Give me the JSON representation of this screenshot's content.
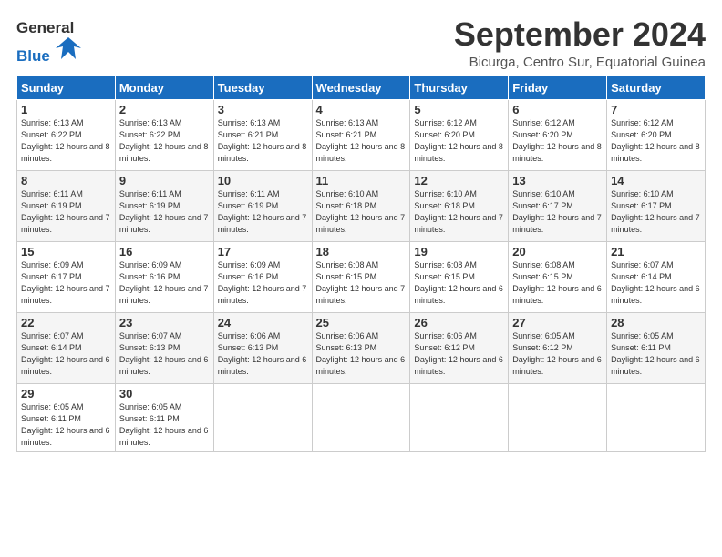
{
  "header": {
    "logo_general": "General",
    "logo_blue": "Blue",
    "title": "September 2024",
    "location": "Bicurga, Centro Sur, Equatorial Guinea"
  },
  "weekdays": [
    "Sunday",
    "Monday",
    "Tuesday",
    "Wednesday",
    "Thursday",
    "Friday",
    "Saturday"
  ],
  "weeks": [
    [
      {
        "day": "1",
        "sunrise": "6:13 AM",
        "sunset": "6:22 PM",
        "daylight": "12 hours and 8 minutes."
      },
      {
        "day": "2",
        "sunrise": "6:13 AM",
        "sunset": "6:22 PM",
        "daylight": "12 hours and 8 minutes."
      },
      {
        "day": "3",
        "sunrise": "6:13 AM",
        "sunset": "6:21 PM",
        "daylight": "12 hours and 8 minutes."
      },
      {
        "day": "4",
        "sunrise": "6:13 AM",
        "sunset": "6:21 PM",
        "daylight": "12 hours and 8 minutes."
      },
      {
        "day": "5",
        "sunrise": "6:12 AM",
        "sunset": "6:20 PM",
        "daylight": "12 hours and 8 minutes."
      },
      {
        "day": "6",
        "sunrise": "6:12 AM",
        "sunset": "6:20 PM",
        "daylight": "12 hours and 8 minutes."
      },
      {
        "day": "7",
        "sunrise": "6:12 AM",
        "sunset": "6:20 PM",
        "daylight": "12 hours and 8 minutes."
      }
    ],
    [
      {
        "day": "8",
        "sunrise": "6:11 AM",
        "sunset": "6:19 PM",
        "daylight": "12 hours and 7 minutes."
      },
      {
        "day": "9",
        "sunrise": "6:11 AM",
        "sunset": "6:19 PM",
        "daylight": "12 hours and 7 minutes."
      },
      {
        "day": "10",
        "sunrise": "6:11 AM",
        "sunset": "6:19 PM",
        "daylight": "12 hours and 7 minutes."
      },
      {
        "day": "11",
        "sunrise": "6:10 AM",
        "sunset": "6:18 PM",
        "daylight": "12 hours and 7 minutes."
      },
      {
        "day": "12",
        "sunrise": "6:10 AM",
        "sunset": "6:18 PM",
        "daylight": "12 hours and 7 minutes."
      },
      {
        "day": "13",
        "sunrise": "6:10 AM",
        "sunset": "6:17 PM",
        "daylight": "12 hours and 7 minutes."
      },
      {
        "day": "14",
        "sunrise": "6:10 AM",
        "sunset": "6:17 PM",
        "daylight": "12 hours and 7 minutes."
      }
    ],
    [
      {
        "day": "15",
        "sunrise": "6:09 AM",
        "sunset": "6:17 PM",
        "daylight": "12 hours and 7 minutes."
      },
      {
        "day": "16",
        "sunrise": "6:09 AM",
        "sunset": "6:16 PM",
        "daylight": "12 hours and 7 minutes."
      },
      {
        "day": "17",
        "sunrise": "6:09 AM",
        "sunset": "6:16 PM",
        "daylight": "12 hours and 7 minutes."
      },
      {
        "day": "18",
        "sunrise": "6:08 AM",
        "sunset": "6:15 PM",
        "daylight": "12 hours and 7 minutes."
      },
      {
        "day": "19",
        "sunrise": "6:08 AM",
        "sunset": "6:15 PM",
        "daylight": "12 hours and 6 minutes."
      },
      {
        "day": "20",
        "sunrise": "6:08 AM",
        "sunset": "6:15 PM",
        "daylight": "12 hours and 6 minutes."
      },
      {
        "day": "21",
        "sunrise": "6:07 AM",
        "sunset": "6:14 PM",
        "daylight": "12 hours and 6 minutes."
      }
    ],
    [
      {
        "day": "22",
        "sunrise": "6:07 AM",
        "sunset": "6:14 PM",
        "daylight": "12 hours and 6 minutes."
      },
      {
        "day": "23",
        "sunrise": "6:07 AM",
        "sunset": "6:13 PM",
        "daylight": "12 hours and 6 minutes."
      },
      {
        "day": "24",
        "sunrise": "6:06 AM",
        "sunset": "6:13 PM",
        "daylight": "12 hours and 6 minutes."
      },
      {
        "day": "25",
        "sunrise": "6:06 AM",
        "sunset": "6:13 PM",
        "daylight": "12 hours and 6 minutes."
      },
      {
        "day": "26",
        "sunrise": "6:06 AM",
        "sunset": "6:12 PM",
        "daylight": "12 hours and 6 minutes."
      },
      {
        "day": "27",
        "sunrise": "6:05 AM",
        "sunset": "6:12 PM",
        "daylight": "12 hours and 6 minutes."
      },
      {
        "day": "28",
        "sunrise": "6:05 AM",
        "sunset": "6:11 PM",
        "daylight": "12 hours and 6 minutes."
      }
    ],
    [
      {
        "day": "29",
        "sunrise": "6:05 AM",
        "sunset": "6:11 PM",
        "daylight": "12 hours and 6 minutes."
      },
      {
        "day": "30",
        "sunrise": "6:05 AM",
        "sunset": "6:11 PM",
        "daylight": "12 hours and 6 minutes."
      },
      null,
      null,
      null,
      null,
      null
    ]
  ]
}
